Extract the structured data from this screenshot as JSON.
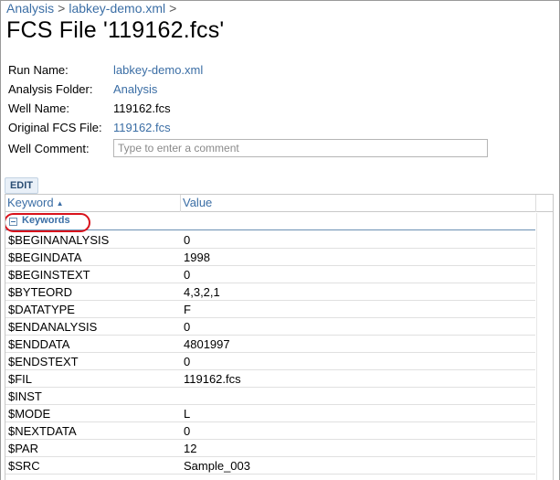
{
  "breadcrumb": [
    {
      "label": "Analysis"
    },
    {
      "label": "labkey-demo.xml"
    }
  ],
  "breadcrumb_separator": ">",
  "title": "FCS File '119162.fcs'",
  "properties": {
    "run_name": {
      "label": "Run Name:",
      "value": "labkey-demo.xml"
    },
    "analysis_folder": {
      "label": "Analysis Folder:",
      "value": "Analysis"
    },
    "well_name": {
      "label": "Well Name:",
      "value": "119162.fcs"
    },
    "original_fcs_file": {
      "label": "Original FCS File:",
      "value": "119162.fcs"
    },
    "well_comment": {
      "label": "Well Comment:",
      "value": "",
      "placeholder": "Type to enter a comment"
    }
  },
  "edit_button": "EDIT",
  "grid": {
    "columns": {
      "keyword": "Keyword",
      "value": "Value"
    },
    "group_label": "Keywords",
    "rows": [
      {
        "keyword": "$BEGINANALYSIS",
        "value": "0"
      },
      {
        "keyword": "$BEGINDATA",
        "value": "1998"
      },
      {
        "keyword": "$BEGINSTEXT",
        "value": "0"
      },
      {
        "keyword": "$BYTEORD",
        "value": "4,3,2,1"
      },
      {
        "keyword": "$DATATYPE",
        "value": "F"
      },
      {
        "keyword": "$ENDANALYSIS",
        "value": "0"
      },
      {
        "keyword": "$ENDDATA",
        "value": "4801997"
      },
      {
        "keyword": "$ENDSTEXT",
        "value": "0"
      },
      {
        "keyword": "$FIL",
        "value": "119162.fcs"
      },
      {
        "keyword": "$INST",
        "value": ""
      },
      {
        "keyword": "$MODE",
        "value": "L"
      },
      {
        "keyword": "$NEXTDATA",
        "value": "0"
      },
      {
        "keyword": "$PAR",
        "value": "12"
      },
      {
        "keyword": "$SRC",
        "value": "Sample_003"
      }
    ]
  },
  "colors": {
    "link": "#3b6ea5",
    "highlight": "#d9121b"
  }
}
